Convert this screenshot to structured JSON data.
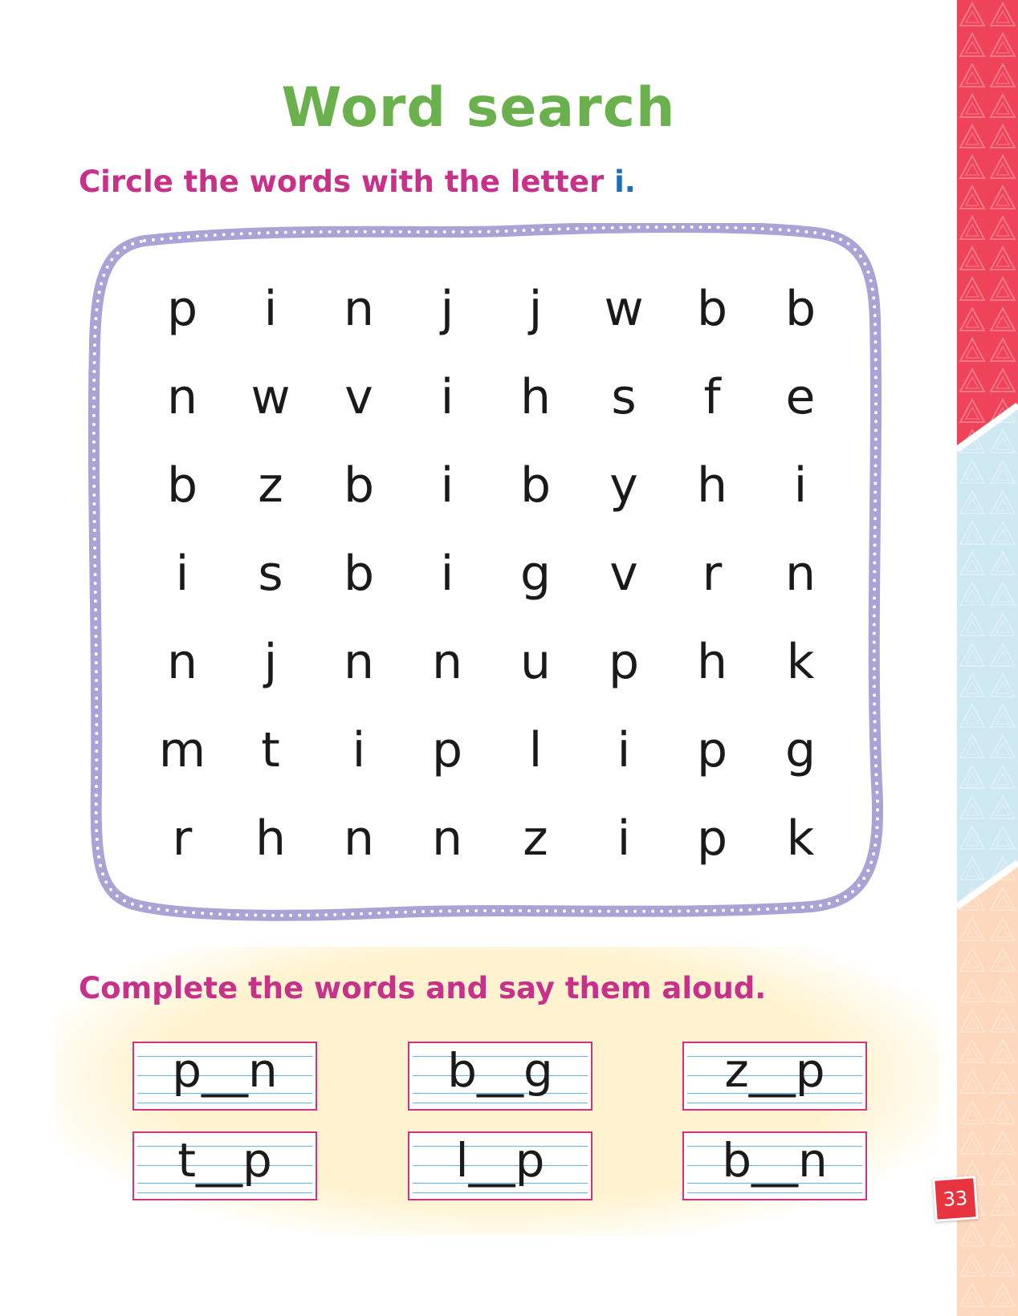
{
  "title": "Word search",
  "instruction_1": {
    "text": "Circle the words with the letter ",
    "letter": "i",
    "period": "."
  },
  "grid": [
    [
      "p",
      "i",
      "n",
      "j",
      "j",
      "w",
      "b",
      "b"
    ],
    [
      "n",
      "w",
      "v",
      "i",
      "h",
      "s",
      "f",
      "e"
    ],
    [
      "b",
      "z",
      "b",
      "i",
      "b",
      "y",
      "h",
      "i"
    ],
    [
      "i",
      "s",
      "b",
      "i",
      "g",
      "v",
      "r",
      "n"
    ],
    [
      "n",
      "j",
      "n",
      "n",
      "u",
      "p",
      "h",
      "k"
    ],
    [
      "m",
      "t",
      "i",
      "p",
      "l",
      "i",
      "p",
      "g"
    ],
    [
      "r",
      "h",
      "n",
      "n",
      "z",
      "i",
      "p",
      "k"
    ]
  ],
  "instruction_2": "Complete the words and say them aloud.",
  "words": [
    "p__n",
    "b__g",
    "z__p",
    "t__p",
    "l__p",
    "b__n"
  ],
  "page_number": "33",
  "colors": {
    "title": "#6ab04c",
    "instruction": "#c8318a",
    "letter_accent": "#1f6fb8",
    "frame": "#a9a3d6",
    "box_border": "#d6317e",
    "side_red": "#ee4358",
    "side_blue": "#cfe9f2",
    "side_peach": "#fdd8bd"
  }
}
